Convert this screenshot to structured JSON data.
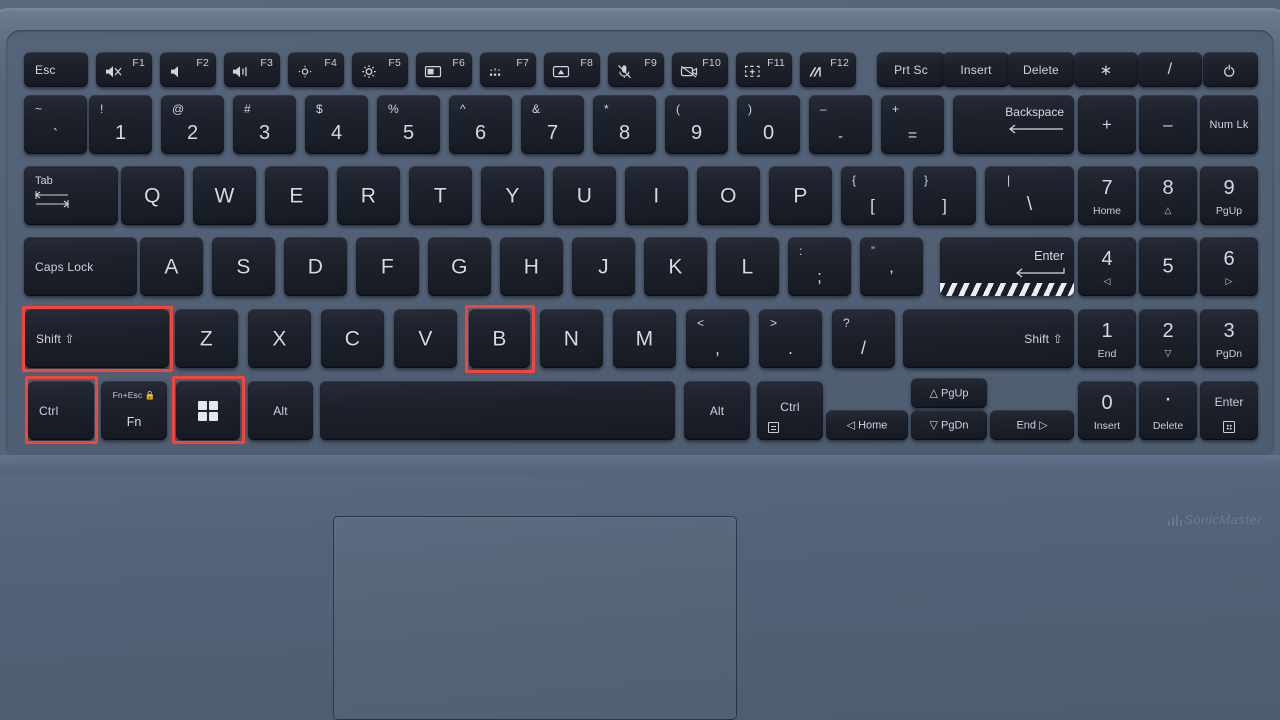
{
  "device": {
    "brand_logo": "SonicMaster",
    "chassis_color": "#55637a",
    "key_color": "#1d212b",
    "key_text_color": "#d3dae6",
    "highlight_color": "#f4453b"
  },
  "highlights": {
    "note": "red outlined keys",
    "keys": [
      "Shift",
      "Ctrl",
      "Windows",
      "B"
    ]
  },
  "rows": {
    "function_row": [
      {
        "name": "esc",
        "label": "Esc",
        "fn": "",
        "icon": ""
      },
      {
        "name": "f1",
        "label": "",
        "fn": "F1",
        "icon": "mute-icon"
      },
      {
        "name": "f2",
        "label": "",
        "fn": "F2",
        "icon": "volume-down-icon"
      },
      {
        "name": "f3",
        "label": "",
        "fn": "F3",
        "icon": "volume-up-icon"
      },
      {
        "name": "f4",
        "label": "",
        "fn": "F4",
        "icon": "brightness-down-icon"
      },
      {
        "name": "f5",
        "label": "",
        "fn": "F5",
        "icon": "brightness-up-icon"
      },
      {
        "name": "f6",
        "label": "",
        "fn": "F6",
        "icon": "touchpad-icon"
      },
      {
        "name": "f7",
        "label": "",
        "fn": "F7",
        "icon": "keyboard-backlight-icon"
      },
      {
        "name": "f8",
        "label": "",
        "fn": "F8",
        "icon": "display-switch-icon"
      },
      {
        "name": "f9",
        "label": "",
        "fn": "F9",
        "icon": "mic-mute-icon"
      },
      {
        "name": "f10",
        "label": "",
        "fn": "F10",
        "icon": "camera-off-icon"
      },
      {
        "name": "f11",
        "label": "",
        "fn": "F11",
        "icon": "snip-icon"
      },
      {
        "name": "f12",
        "label": "",
        "fn": "F12",
        "icon": "myasus-icon"
      },
      {
        "name": "prtsc",
        "label": "Prt Sc",
        "fn": "",
        "icon": ""
      },
      {
        "name": "insert",
        "label": "Insert",
        "fn": "",
        "icon": ""
      },
      {
        "name": "delete",
        "label": "Delete",
        "fn": "",
        "icon": ""
      },
      {
        "name": "numpad-multiply",
        "label": "∗",
        "fn": "",
        "icon": ""
      },
      {
        "name": "numpad-divide",
        "label": "/",
        "fn": "",
        "icon": ""
      },
      {
        "name": "power",
        "label": "",
        "fn": "",
        "icon": "power-icon"
      }
    ],
    "number_row": [
      {
        "name": "backtick",
        "upper": "~",
        "lower": "`"
      },
      {
        "name": "one",
        "upper": "!",
        "lower": "1"
      },
      {
        "name": "two",
        "upper": "@",
        "lower": "2"
      },
      {
        "name": "three",
        "upper": "#",
        "lower": "3"
      },
      {
        "name": "four",
        "upper": "$",
        "lower": "4"
      },
      {
        "name": "five",
        "upper": "%",
        "lower": "5"
      },
      {
        "name": "six",
        "upper": "^",
        "lower": "6"
      },
      {
        "name": "seven",
        "upper": "&",
        "lower": "7"
      },
      {
        "name": "eight",
        "upper": "*",
        "lower": "8"
      },
      {
        "name": "nine",
        "upper": "(",
        "lower": "9"
      },
      {
        "name": "zero",
        "upper": ")",
        "lower": "0"
      },
      {
        "name": "minus",
        "upper": "–",
        "lower": "-"
      },
      {
        "name": "equals",
        "upper": "+",
        "lower": "="
      }
    ],
    "number_row_right": [
      {
        "name": "backspace",
        "label": "Backspace"
      },
      {
        "name": "numpad-plus",
        "label": "+"
      },
      {
        "name": "numpad-minus",
        "label": "–"
      },
      {
        "name": "num-lock",
        "label": "Num Lk"
      }
    ],
    "qwerty_row": {
      "tab": "Tab",
      "letters": [
        "Q",
        "W",
        "E",
        "R",
        "T",
        "Y",
        "U",
        "I",
        "O",
        "P"
      ],
      "bracket_left": {
        "upper": "{",
        "lower": "["
      },
      "bracket_right": {
        "upper": "}",
        "lower": "]"
      },
      "backslash": {
        "upper": "|",
        "lower": "\\"
      }
    },
    "home_row": {
      "caps_lock": "Caps Lock",
      "letters": [
        "A",
        "S",
        "D",
        "F",
        "G",
        "H",
        "J",
        "K",
        "L"
      ],
      "semicolon": {
        "upper": ":",
        "lower": ";"
      },
      "quote": {
        "upper": "”",
        "lower": "’"
      },
      "enter": "Enter"
    },
    "shift_row": {
      "shift_left": "Shift",
      "letters": [
        "Z",
        "X",
        "C",
        "V",
        "B",
        "N",
        "M"
      ],
      "comma": {
        "upper": "<",
        "lower": ","
      },
      "period": {
        "upper": ">",
        "lower": "."
      },
      "slash": {
        "upper": "?",
        "lower": "/"
      },
      "shift_right": "Shift"
    },
    "bottom_row": {
      "ctrl_left": "Ctrl",
      "fn_top": "Fn+Esc",
      "fn": "Fn",
      "windows": "",
      "alt_left": "Alt",
      "space": "",
      "alt_right": "Alt",
      "ctrl_right": "Ctrl",
      "home": "Home",
      "pgup": "PgUp",
      "pgdn": "PgDn",
      "end": "End"
    },
    "numpad": [
      {
        "name": "np7",
        "digit": "7",
        "sub": "Home",
        "subicon": ""
      },
      {
        "name": "np8",
        "digit": "8",
        "sub": "",
        "subicon": "△"
      },
      {
        "name": "np9",
        "digit": "9",
        "sub": "PgUp",
        "subicon": ""
      },
      {
        "name": "np4",
        "digit": "4",
        "sub": "",
        "subicon": "◁"
      },
      {
        "name": "np5",
        "digit": "5",
        "sub": "",
        "subicon": ""
      },
      {
        "name": "np6",
        "digit": "6",
        "sub": "",
        "subicon": "▷"
      },
      {
        "name": "np1",
        "digit": "1",
        "sub": "End",
        "subicon": ""
      },
      {
        "name": "np2",
        "digit": "2",
        "sub": "",
        "subicon": "▽"
      },
      {
        "name": "np3",
        "digit": "3",
        "sub": "PgDn",
        "subicon": ""
      },
      {
        "name": "np0",
        "digit": "0",
        "sub": "Insert",
        "subicon": ""
      },
      {
        "name": "npdot",
        "digit": "·",
        "sub": "Delete",
        "subicon": ""
      },
      {
        "name": "npenter",
        "digit": "",
        "sub": "Enter",
        "subicon": ""
      }
    ]
  }
}
